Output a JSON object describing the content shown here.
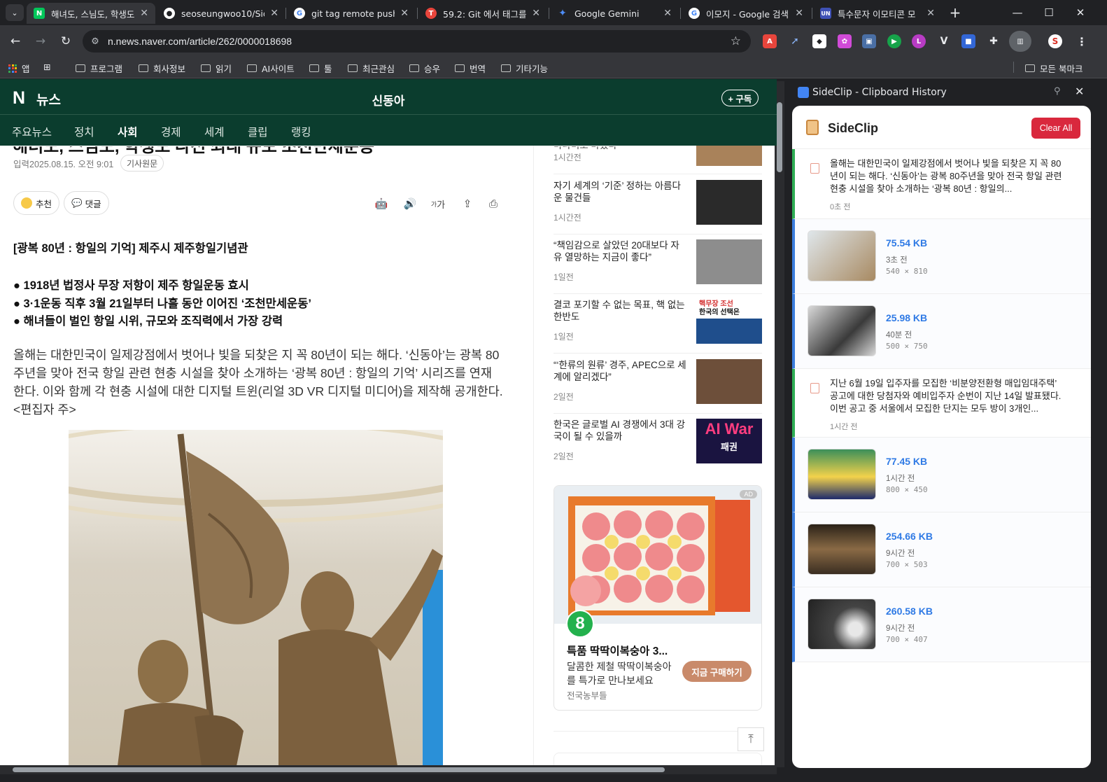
{
  "browser": {
    "tabs": [
      {
        "title": "해녀도, 스님도, 학생도",
        "favicon": "N",
        "fav_color": "#03c75a",
        "active": true
      },
      {
        "title": "seoseungwoo10/Side",
        "favicon": "github",
        "fav_color": "#ffffff",
        "active": false
      },
      {
        "title": "git tag remote push -",
        "favicon": "G",
        "fav_color": "#ffffff",
        "active": false
      },
      {
        "title": "59.2: Git 에서 태그를",
        "favicon": "T",
        "fav_color": "#e8453c",
        "active": false
      },
      {
        "title": "Google Gemini",
        "favicon": "gemini",
        "fav_color": "#4e8cf5",
        "active": false
      },
      {
        "title": "이모지 - Google 검색",
        "favicon": "G",
        "fav_color": "#ffffff",
        "active": false
      },
      {
        "title": "특수문자 이모티콘 모",
        "favicon": "UN",
        "fav_color": "#3f51b5",
        "active": false
      }
    ],
    "url": "n.news.naver.com/article/262/0000018698",
    "bookmarks": {
      "apps_label": "앱",
      "folders": [
        "프로그램",
        "회사정보",
        "읽기",
        "AI사이트",
        "툴",
        "최근관심",
        "승우",
        "번역",
        "기타기능"
      ],
      "all_bookmarks": "모든 북마크"
    }
  },
  "article": {
    "logo": "N",
    "news_label": "뉴스",
    "press": "신동아",
    "subscribe": "+ 구독",
    "nav": [
      "주요뉴스",
      "정치",
      "사회",
      "경제",
      "세계",
      "클립",
      "랭킹"
    ],
    "active_nav": "사회",
    "cut_title": "해녀도, 스님도, 학생도 나선 최대 규모 조천만세운동",
    "meta": "입력2025.08.15. 오전 9:01",
    "original_btn": "기사원문",
    "recommend": "추천",
    "comment": "댓글",
    "text_size_label": "가",
    "headline": "[광복 80년 : 항일의 기억] 제주시 제주항일기념관",
    "bullets": [
      "● 1918년 법정사 무장 저항이 제주 항일운동 효시",
      "● 3·1운동 직후 3월 21일부터 나흘 동안 이어진 ‘조천만세운동’",
      "● 해녀들이 벌인 항일 시위, 규모와 조직력에서 가장 강력"
    ],
    "body": "올해는 대한민국이 일제강점에서 벗어나 빛을 되찾은 지 꼭 80년이 되는 해다. ‘신동아’는 광복 80주년을 맞아 전국 항일 관련 현충 시설을 찾아 소개하는 ‘광복 80년 : 항일의 기억’ 시리즈를 연재한다. 이와 함께 각 현충 시설에 대한 디지털 트윈(리얼 3D VR 디지털 미디어)을 제작해 공개한다. <편집자 주>"
  },
  "related": [
    {
      "title": "마나미로 바꿨다",
      "time": "1시간전",
      "thumb": "#a9825a"
    },
    {
      "title": "자기 세계의 ‘기준’ 정하는 아름다운 물건들",
      "time": "1시간전",
      "thumb": "#2a2a2a"
    },
    {
      "title": "“책임감으로 살았던 20대보다 자유 열망하는 지금이 좋다”",
      "time": "1일전",
      "thumb": "#8d8d8d"
    },
    {
      "title": "결코 포기할 수 없는 목표, 핵 없는 한반도",
      "time": "1일전",
      "thumb": "#1f4e8c"
    },
    {
      "title": "“‘한류의 원류’ 경주, APEC으로 세계에 알리겠다”",
      "time": "2일전",
      "thumb": "#6d4f3a"
    },
    {
      "title": "한국은 글로벌 AI 경쟁에서 3대 강국이 될 수 있을까",
      "time": "2일전",
      "thumb": "#1a1440"
    }
  ],
  "related_thumb_text": {
    "t3_line1": "핵무장 조선",
    "t3_line2": "한국의 선택은",
    "t5": "AI War",
    "t5_sub": "패권"
  },
  "ad": {
    "badge": "AD",
    "logo": "8",
    "title": "특품 딱딱이복숭아 3...",
    "desc": "달콤한 제철 딱딱이복숭아를 특가로 만나보세요",
    "store": "전국농부들",
    "cta": "지금 구매하기"
  },
  "sideclip": {
    "window_title": "SideClip - Clipboard History",
    "app_name": "SideClip",
    "clear_all": "Clear All",
    "items": [
      {
        "kind": "text",
        "text": "올해는 대한민국이 일제강점에서 벗어나 빛을 되찾은 지 꼭 80년이 되는 해다. ‘신동아’는 광복 80주년을 맞아 전국 항일 관련 현충 시설을 찾아 소개하는 ‘광복 80년 : 항일의...",
        "ago": "0초 전"
      },
      {
        "kind": "image",
        "size": "75.54 KB",
        "ago": "3초 전",
        "dim": "540 × 810",
        "thumb": "#a88a62"
      },
      {
        "kind": "image",
        "size": "25.98 KB",
        "ago": "40분 전",
        "dim": "500 × 750",
        "thumb": "#3a3a3a"
      },
      {
        "kind": "text",
        "text": "지난 6월 19일 입주자를 모집한 ‘비분양전환형 매입임대주택’ 공고에 대한 당첨자와 예비입주자 순번이 지난 14일 발표됐다. 이번 공고 중 서울에서 모집한 단지는 모두 방이 3개인...",
        "ago": "1시간 전"
      },
      {
        "kind": "image",
        "size": "77.45 KB",
        "ago": "1시간 전",
        "dim": "800 × 450",
        "thumb": "#3c8f5a"
      },
      {
        "kind": "image",
        "size": "254.66 KB",
        "ago": "9시간 전",
        "dim": "700 × 503",
        "thumb": "#5a4632"
      },
      {
        "kind": "image",
        "size": "260.58 KB",
        "ago": "9시간 전",
        "dim": "700 × 407",
        "thumb": "#444444"
      }
    ]
  },
  "colors": {
    "naver_header": "#0b3d2e",
    "accent_green": "#2fae55",
    "accent_blue": "#3b7ddd",
    "clear_red": "#d9283d"
  }
}
